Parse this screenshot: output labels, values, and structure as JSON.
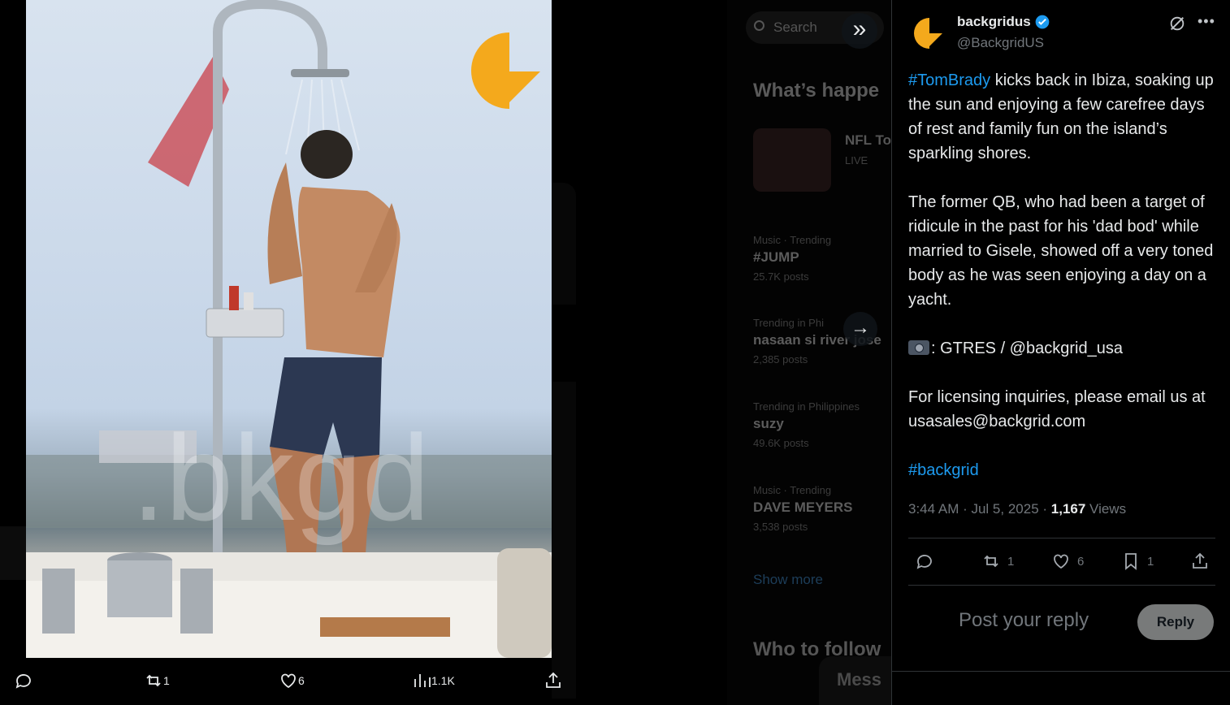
{
  "background": {
    "search_placeholder": "Search",
    "whats_happening": "What’s happe",
    "nfl_title": "NFL To",
    "nfl_live": "LIVE",
    "trends": [
      {
        "context": "Music · Trending",
        "name": "#JUMP",
        "count": "25.7K posts"
      },
      {
        "context": "Trending in Phi",
        "name": "nasaan si river jose",
        "count": "2,385 posts"
      },
      {
        "context": "Trending in Philippines",
        "name": "suzy",
        "count": "49.6K posts"
      },
      {
        "context": "Music · Trending",
        "name": "DAVE MEYERS",
        "count": "3,538 posts"
      }
    ],
    "show_more": "Show more",
    "who_to_follow": "Who to follow",
    "messages": "Mess"
  },
  "media": {
    "watermark": ".bkgd",
    "actions": {
      "reply_count": "",
      "repost_count": "1",
      "like_count": "6",
      "views_count": "1.1K"
    }
  },
  "tweet": {
    "display_name": "backgridus",
    "handle": "@BackgridUS",
    "paragraphs": {
      "p1_hashtag": "#TomBrady",
      "p1_rest": " kicks back in Ibiza, soaking up the sun and enjoying a few carefree days of rest and family fun on the island’s sparkling shores.",
      "p2": "The former QB, who had been a target of ridicule in the past for his 'dad bod' while married to Gisele, showed off a very toned body as he was seen enjoying a day on a yacht.",
      "p3": ": GTRES / @backgrid_usa",
      "p4": "For licensing inquiries, please email us at usasales@backgrid.com",
      "p5_hashtag": "#backgrid"
    },
    "time": "3:44 AM · Jul 5, 2025 · ",
    "views_number": "1,167",
    "views_label": " Views",
    "actions": {
      "repost_count": "1",
      "like_count": "6",
      "bookmark_count": "1"
    },
    "reply_placeholder": "Post your reply",
    "reply_button": "Reply"
  },
  "colors": {
    "accent": "#1d9bf0",
    "logo": "#f4a91c"
  }
}
